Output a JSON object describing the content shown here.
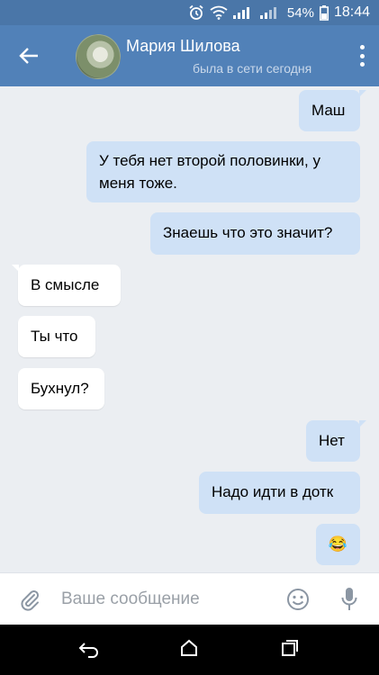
{
  "status_bar": {
    "battery": "54%",
    "time": "18:44"
  },
  "header": {
    "name": "Мария Шилова",
    "status": "была в сети сегодня"
  },
  "messages": [
    {
      "side": "out",
      "text": "Маш"
    },
    {
      "side": "out",
      "text": "У тебя нет второй половинки, у меня тоже."
    },
    {
      "side": "out",
      "text": "Знаешь что это значит?"
    },
    {
      "side": "in",
      "text": "В смысле"
    },
    {
      "side": "in",
      "text": "Ты что"
    },
    {
      "side": "in",
      "text": "Бухнул?"
    },
    {
      "side": "out",
      "text": "Нет"
    },
    {
      "side": "out",
      "text": "Надо идти в дотк"
    },
    {
      "side": "out",
      "text": "😂"
    }
  ],
  "composer": {
    "placeholder": "Ваше сообщение"
  },
  "colors": {
    "header": "#5181b8",
    "statusbar": "#4a76a8",
    "outgoing": "#cfe1f6",
    "incoming": "#ffffff",
    "background": "#ebeef2"
  },
  "icons": [
    "back-arrow-icon",
    "more-vertical-icon",
    "attach-icon",
    "emoji-icon",
    "mic-icon",
    "nav-back-icon",
    "nav-home-icon",
    "nav-recent-icon",
    "alarm-icon",
    "wifi-icon",
    "signal-icon",
    "battery-icon"
  ]
}
